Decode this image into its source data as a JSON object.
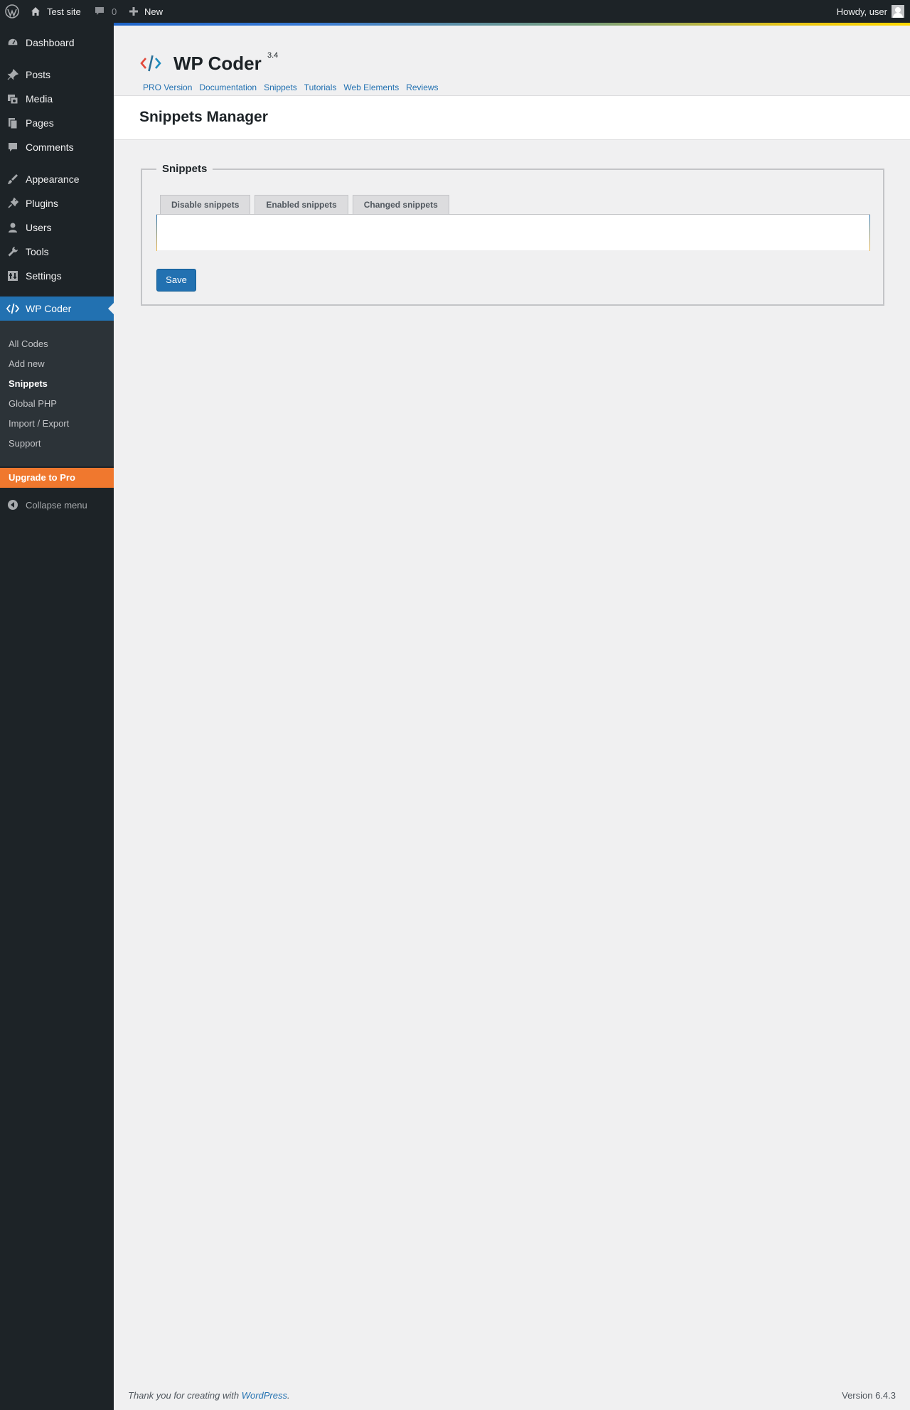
{
  "admin_bar": {
    "site_name": "Test site",
    "comments_count": "0",
    "new_label": "New",
    "howdy": "Howdy, user"
  },
  "sidebar": {
    "items": [
      {
        "label": "Dashboard",
        "icon": "dashboard-icon"
      },
      {
        "label": "Posts",
        "icon": "pushpin-icon"
      },
      {
        "label": "Media",
        "icon": "media-icon"
      },
      {
        "label": "Pages",
        "icon": "pages-icon"
      },
      {
        "label": "Comments",
        "icon": "comment-icon"
      },
      {
        "label": "Appearance",
        "icon": "brush-icon"
      },
      {
        "label": "Plugins",
        "icon": "plug-icon"
      },
      {
        "label": "Users",
        "icon": "user-icon"
      },
      {
        "label": "Tools",
        "icon": "wrench-icon"
      },
      {
        "label": "Settings",
        "icon": "settings-icon"
      },
      {
        "label": "WP Coder",
        "icon": "code-icon"
      }
    ],
    "submenu": [
      {
        "label": "All Codes"
      },
      {
        "label": "Add new"
      },
      {
        "label": "Snippets"
      },
      {
        "label": "Global PHP"
      },
      {
        "label": "Import / Export"
      },
      {
        "label": "Support"
      }
    ],
    "upgrade": "Upgrade to Pro",
    "collapse": "Collapse menu"
  },
  "plugin": {
    "title": "WP Coder",
    "version": "3.4",
    "links": [
      "PRO Version",
      "Documentation",
      "Snippets",
      "Tutorials",
      "Web Elements",
      "Reviews"
    ]
  },
  "page": {
    "title": "Snippets Manager",
    "fieldset_legend": "Snippets",
    "tabs": [
      "Disable snippets",
      "Enabled snippets",
      "Changed snippets"
    ],
    "save_label": "Save"
  },
  "footer": {
    "thanks_prefix": "Thank you for creating with ",
    "thanks_link": "WordPress",
    "thanks_suffix": ".",
    "version": "Version 6.4.3"
  },
  "colors": {
    "admin_dark": "#1d2327",
    "primary": "#2271b1",
    "upgrade": "#f0782e",
    "background": "#f0f0f1"
  }
}
